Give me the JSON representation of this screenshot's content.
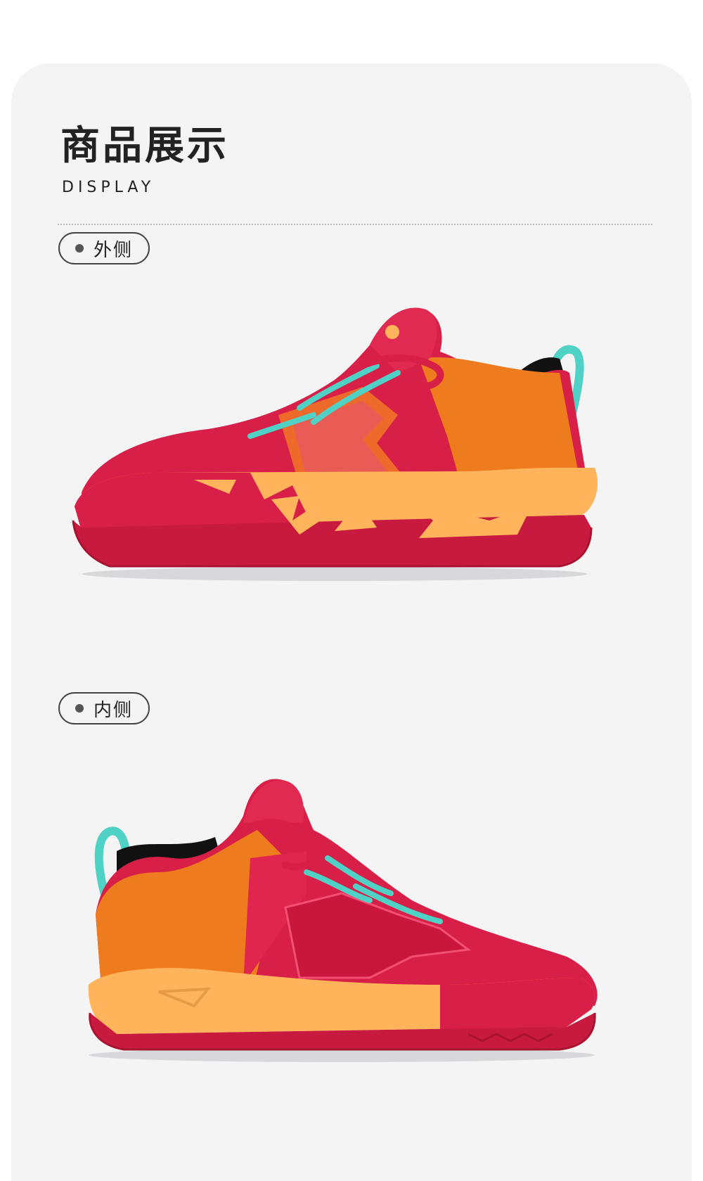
{
  "header": {
    "title": "商品展示",
    "subtitle": "DISPLAY"
  },
  "views": [
    {
      "label": "外侧",
      "image_description": "lateral side view of red and orange basketball shoe"
    },
    {
      "label": "内侧",
      "image_description": "medial side view of red and orange basketball shoe"
    }
  ],
  "colors": {
    "page_background": "#ffffff",
    "card_background": "#f4f4f5",
    "shoe_red": "#d81f47",
    "shoe_dark_red": "#b8163a",
    "shoe_orange": "#ee7b1e",
    "shoe_light_orange": "#ffb45c",
    "shoe_teal": "#4fd1c5",
    "text_dark": "#222222"
  }
}
